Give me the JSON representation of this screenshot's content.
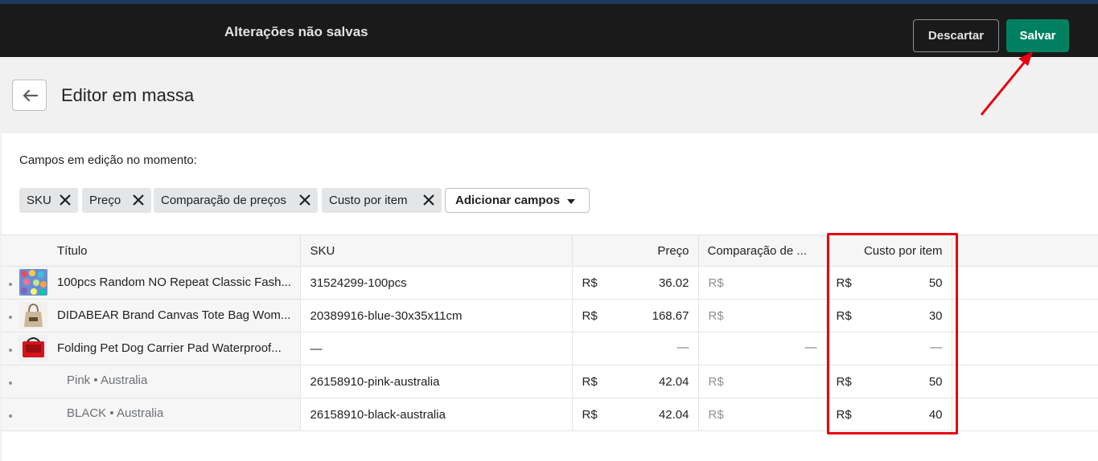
{
  "topbar": {
    "title": "Alterações não salvas",
    "discard_label": "Descartar",
    "save_label": "Salvar",
    "save_color": "#008060"
  },
  "page": {
    "title": "Editor em massa",
    "back_icon": "arrow-left-icon"
  },
  "fields": {
    "label": "Campos em edição no momento:",
    "tags": [
      "SKU",
      "Preço",
      "Comparação de preços",
      "Custo por item"
    ],
    "add_label": "Adicionar campos"
  },
  "table": {
    "headers": {
      "title": "Título",
      "sku": "SKU",
      "price": "Preço",
      "compare": "Comparação de ...",
      "cost": "Custo por item"
    },
    "currency": "R$",
    "dash": "—",
    "rows": [
      {
        "title": "100pcs Random NO Repeat Classic Fash...",
        "sku": "31524299-100pcs",
        "price": "36.02",
        "cost": "50"
      },
      {
        "title": "DIDABEAR Brand Canvas Tote Bag Wom...",
        "sku": "20389916-blue-30x35x11cm",
        "price": "168.67",
        "cost": "30"
      },
      {
        "title": "Folding Pet Dog Carrier Pad Waterproof...",
        "sku": "—",
        "price": "—",
        "compare": "—",
        "cost": "—"
      },
      {
        "title": "Pink • Australia",
        "sku": "26158910-pink-australia",
        "price": "42.04",
        "cost": "50"
      },
      {
        "title": "BLACK • Australia",
        "sku": "26158910-black-australia",
        "price": "42.04",
        "cost": "40"
      }
    ]
  },
  "annotation": {
    "highlight_color": "#e60012"
  }
}
